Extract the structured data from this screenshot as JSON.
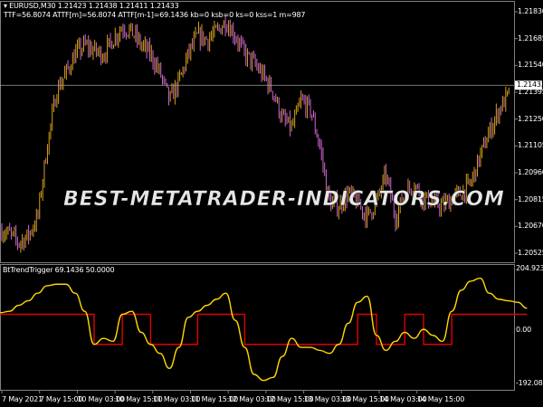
{
  "header": {
    "symbol_line": "EURUSD,M30  1.21423 1.21438 1.21411 1.21433",
    "info_line": "TTF=56.8074 ATTF[m]=56.8074 ATTF[m-1]=69.1436 kb=0 ksb=0 ks=0 kss=1 m=987"
  },
  "watermark": "BEST-METATRADER-INDICATORS.COM",
  "indicator": {
    "title": "BtTrendTrigger 69.1436 50.0000"
  },
  "colors": {
    "bull": "#d4a017",
    "bear": "#cc66cc",
    "signal": "#ffd700",
    "trigger": "#e00000",
    "grid": "#808080"
  },
  "chart_data": [
    {
      "type": "candlestick",
      "symbol": "EURUSD",
      "timeframe": "M30",
      "current_price": 1.21433,
      "ylim": [
        1.2045,
        1.219
      ],
      "y_ticks": [
        "1.21830",
        "1.21685",
        "1.21540",
        "1.21395",
        "1.21250",
        "1.21105",
        "1.20960",
        "1.20815",
        "1.20670",
        "1.20525"
      ],
      "current_price_label": "1.21433",
      "x_ticks": [
        "7 May 2021",
        "7 May 15:00",
        "10 May 03:00",
        "10 May 15:00",
        "11 May 03:00",
        "11 May 15:00",
        "12 May 03:00",
        "12 May 15:00",
        "13 May 03:00",
        "13 May 15:00",
        "14 May 03:00",
        "14 May 15:00"
      ],
      "close_samples_3h": [
        1.2065,
        1.2063,
        1.2058,
        1.2062,
        1.2072,
        1.211,
        1.214,
        1.215,
        1.216,
        1.2165,
        1.2162,
        1.216,
        1.2168,
        1.2175,
        1.2172,
        1.2165,
        1.216,
        1.215,
        1.2135,
        1.2145,
        1.216,
        1.217,
        1.2168,
        1.2172,
        1.2178,
        1.217,
        1.216,
        1.2155,
        1.2148,
        1.214,
        1.2125,
        1.212,
        1.2135,
        1.213,
        1.211,
        1.208,
        1.2078,
        1.2085,
        1.208,
        1.2072,
        1.208,
        1.2095,
        1.2072,
        1.2085,
        1.209,
        1.2082,
        1.208,
        1.2078,
        1.2082,
        1.2085,
        1.209,
        1.2105,
        1.2118,
        1.213,
        1.2138,
        1.214,
        1.2143
      ]
    },
    {
      "type": "line",
      "title": "BtTrendTrigger",
      "ylim": [
        -192.0817,
        204.923
      ],
      "y_ticks": [
        "204.923",
        "0.00",
        "-192.0817"
      ],
      "series": [
        {
          "values": [
            55,
            60,
            80,
            95,
            120,
            145,
            150,
            150,
            120,
            60,
            -50,
            -30,
            -40,
            50,
            60,
            -10,
            -50,
            -80,
            -130,
            -60,
            40,
            60,
            80,
            100,
            120,
            30,
            -60,
            -150,
            -170,
            -160,
            -90,
            -30,
            -60,
            -60,
            -70,
            -80,
            -50,
            20,
            90,
            110,
            -20,
            -70,
            -40,
            -10,
            -30,
            0,
            -20,
            -40,
            60,
            130,
            160,
            170,
            120,
            100,
            95,
            90,
            70
          ]
        },
        {
          "values": [
            50,
            50,
            50,
            50,
            50,
            50,
            50,
            50,
            50,
            50,
            -50,
            -50,
            -50,
            50,
            50,
            50,
            -50,
            -50,
            -50,
            -50,
            -50,
            50,
            50,
            50,
            50,
            50,
            -50,
            -50,
            -50,
            -50,
            -50,
            -50,
            -50,
            -50,
            -50,
            -50,
            -50,
            -50,
            50,
            50,
            -50,
            -50,
            -50,
            50,
            50,
            -50,
            -50,
            -50,
            50,
            50,
            50,
            50,
            50,
            50,
            50,
            50,
            50
          ]
        }
      ]
    }
  ]
}
